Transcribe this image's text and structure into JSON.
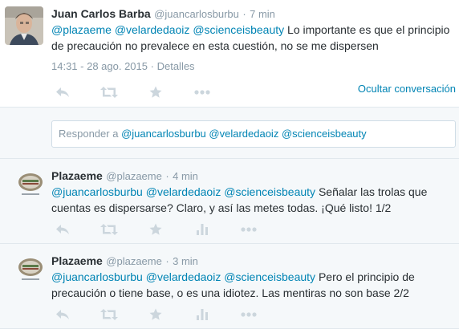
{
  "main_tweet": {
    "author_name": "Juan Carlos Barba",
    "handle": "@juancarlosburbu",
    "time": "7 min",
    "mentions": [
      "@plazaeme",
      "@velardedaoiz",
      "@scienceisbeauty"
    ],
    "text": "Lo importante es que el principio de precaución no prevalece en esta cuestión, no se me dispersen",
    "timestamp": "14:31 - 28 ago. 2015",
    "separator": "·",
    "details_label": "Detalles",
    "hide_conversation_label": "Ocultar conversación"
  },
  "reply_box": {
    "prefix": "Responder a",
    "mentions": [
      "@juancarlosburbu",
      "@velardedaoiz",
      "@scienceisbeauty"
    ]
  },
  "replies": [
    {
      "author_name": "Plazaeme",
      "handle": "@plazaeme",
      "time": "4 min",
      "mentions": [
        "@juancarlosburbu",
        "@velardedaoiz",
        "@scienceisbeauty"
      ],
      "text": "Señalar las trolas que cuentas es dispersarse? Claro, y así las metes todas. ¡Qué listo! 1/2"
    },
    {
      "author_name": "Plazaeme",
      "handle": "@plazaeme",
      "time": "3 min",
      "mentions": [
        "@juancarlosburbu",
        "@velardedaoiz",
        "@scienceisbeauty"
      ],
      "text": "Pero el principio de precaución o tiene base, o es una idiotez. Las mentiras no son base 2/2"
    }
  ],
  "colors": {
    "link": "#0084b4",
    "muted": "#8899a6",
    "icon": "#ccd6dd",
    "text": "#292f33"
  },
  "icons": [
    "reply-icon",
    "retweet-icon",
    "favorite-icon",
    "analytics-icon",
    "more-icon"
  ]
}
